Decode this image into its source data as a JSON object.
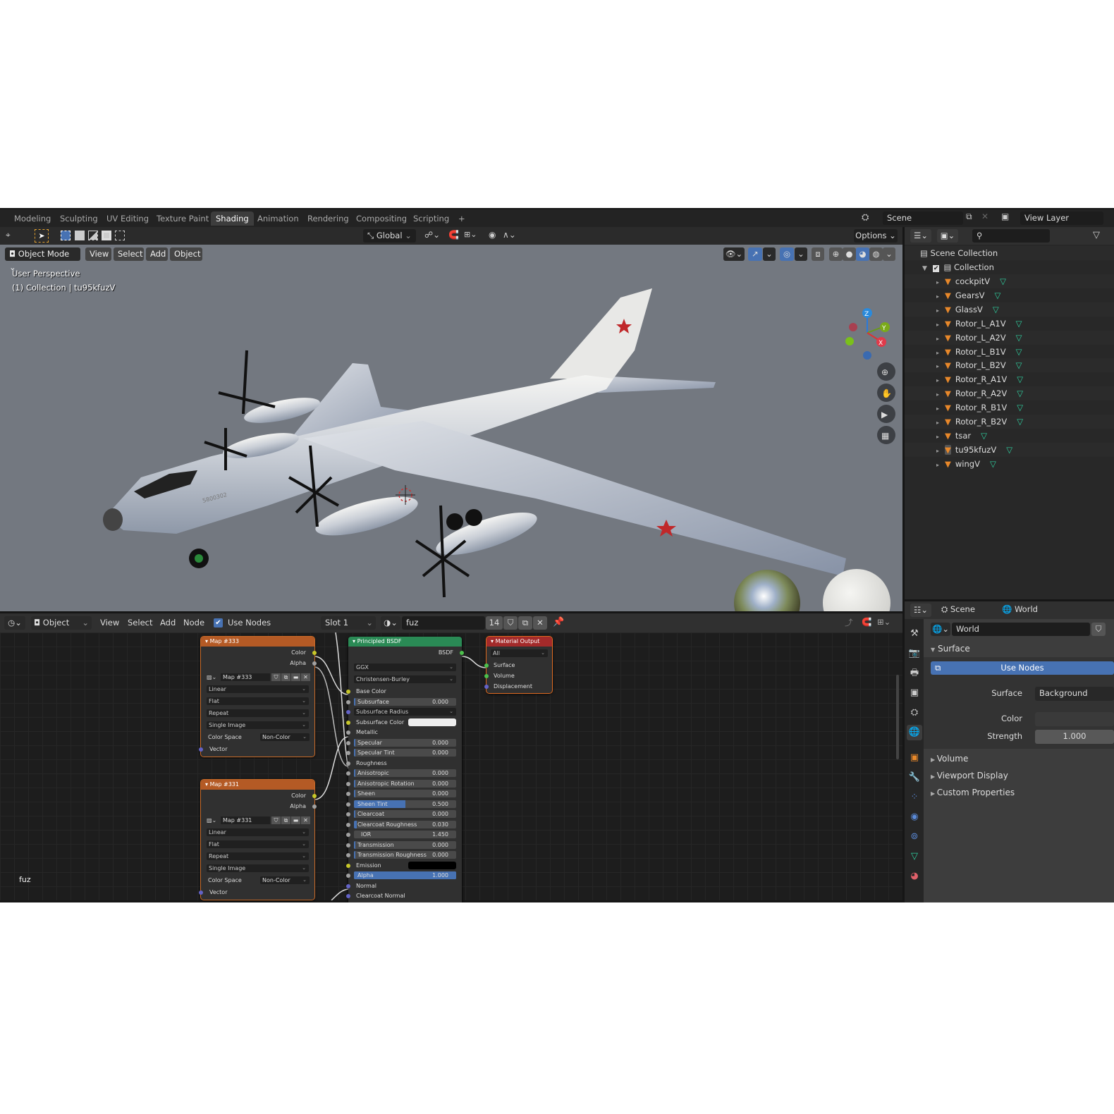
{
  "topbar": {
    "tabs": [
      "Modeling",
      "Sculpting",
      "UV Editing",
      "Texture Paint",
      "Shading",
      "Animation",
      "Rendering",
      "Compositing",
      "Scripting"
    ],
    "active_tab": "Shading",
    "add_tab": "+",
    "scene": "Scene",
    "view_layer": "View Layer"
  },
  "tool_header": {
    "orientation": "Global",
    "options": "Options"
  },
  "viewport": {
    "mode": "Object Mode",
    "menus": [
      "View",
      "Select",
      "Add",
      "Object"
    ],
    "perspective": "User Perspective",
    "collection_info": "(1) Collection | tu95kfuzV",
    "gizmo": {
      "z": "Z",
      "y": "Y",
      "x": "X"
    },
    "aircraft_marking": "5800302"
  },
  "outliner": {
    "root": "Scene Collection",
    "collection": "Collection",
    "items": [
      "cockpitV",
      "GearsV",
      "GlassV",
      "Rotor_L_A1V",
      "Rotor_L_A2V",
      "Rotor_L_B1V",
      "Rotor_L_B2V",
      "Rotor_R_A1V",
      "Rotor_R_A2V",
      "Rotor_R_B1V",
      "Rotor_R_B2V",
      "tsar",
      "tu95kfuzV",
      "wingV"
    ],
    "active_item": "tu95kfuzV"
  },
  "properties": {
    "scene": "Scene",
    "world": "World",
    "world_name": "World",
    "surface_panel": "Surface",
    "use_nodes": "Use Nodes",
    "surface_label": "Surface",
    "surface_value": "Background",
    "color_label": "Color",
    "strength_label": "Strength",
    "strength_value": "1.000",
    "panels": [
      "Volume",
      "Viewport Display",
      "Custom Properties"
    ]
  },
  "node_editor": {
    "editor_type": "Object",
    "menus": [
      "View",
      "Select",
      "Add",
      "Node"
    ],
    "use_nodes": "Use Nodes",
    "use_nodes_checked": true,
    "slot": "Slot 1",
    "material": "fuz",
    "users": "14",
    "material_label": "fuz",
    "map_nodes": [
      {
        "title": "Map #333",
        "outputs": [
          "Color",
          "Alpha"
        ],
        "image": "Map #333",
        "options": [
          "Linear",
          "Flat",
          "Repeat",
          "Single Image"
        ],
        "color_space_label": "Color Space",
        "color_space": "Non-Color",
        "input": "Vector"
      },
      {
        "title": "Map #331",
        "outputs": [
          "Color",
          "Alpha"
        ],
        "image": "Map #331",
        "options": [
          "Linear",
          "Flat",
          "Repeat",
          "Single Image"
        ],
        "color_space_label": "Color Space",
        "color_space": "Non-Color",
        "input": "Vector"
      }
    ],
    "principled": {
      "title": "Principled BSDF",
      "output": "BSDF",
      "distribution": "GGX",
      "subsurface_method": "Christensen-Burley",
      "inputs": [
        {
          "label": "Base Color",
          "kind": "socket",
          "socket": "color"
        },
        {
          "label": "Subsurface",
          "kind": "value",
          "value": "0.000",
          "fill": 0,
          "socket": "float"
        },
        {
          "label": "Subsurface Radius",
          "kind": "dropdown",
          "socket": "vector"
        },
        {
          "label": "Subsurface Color",
          "kind": "color",
          "swatch": "#eeeeee",
          "socket": "color"
        },
        {
          "label": "Metallic",
          "kind": "socket",
          "socket": "float"
        },
        {
          "label": "Specular",
          "kind": "value",
          "value": "0.000",
          "fill": 0,
          "socket": "float"
        },
        {
          "label": "Specular Tint",
          "kind": "value",
          "value": "0.000",
          "fill": 0,
          "socket": "float"
        },
        {
          "label": "Roughness",
          "kind": "socket",
          "socket": "float"
        },
        {
          "label": "Anisotropic",
          "kind": "value",
          "value": "0.000",
          "fill": 0,
          "socket": "float"
        },
        {
          "label": "Anisotropic Rotation",
          "kind": "value",
          "value": "0.000",
          "fill": 0,
          "socket": "float"
        },
        {
          "label": "Sheen",
          "kind": "value",
          "value": "0.000",
          "fill": 0,
          "socket": "float"
        },
        {
          "label": "Sheen Tint",
          "kind": "value",
          "value": "0.500",
          "fill": 0.5,
          "socket": "float"
        },
        {
          "label": "Clearcoat",
          "kind": "value",
          "value": "0.000",
          "fill": 0,
          "socket": "float"
        },
        {
          "label": "Clearcoat Roughness",
          "kind": "value",
          "value": "0.030",
          "fill": 0.03,
          "socket": "float"
        },
        {
          "label": "IOR",
          "kind": "value",
          "value": "1.450",
          "socket": "float"
        },
        {
          "label": "Transmission",
          "kind": "value",
          "value": "0.000",
          "fill": 0,
          "socket": "float"
        },
        {
          "label": "Transmission Roughness",
          "kind": "value",
          "value": "0.000",
          "fill": 0,
          "socket": "float"
        },
        {
          "label": "Emission",
          "kind": "color",
          "swatch": "#000000",
          "socket": "color"
        },
        {
          "label": "Alpha",
          "kind": "value",
          "value": "1.000",
          "fill": 1,
          "socket": "float"
        },
        {
          "label": "Normal",
          "kind": "socket",
          "socket": "vector"
        },
        {
          "label": "Clearcoat Normal",
          "kind": "socket",
          "socket": "vector"
        }
      ]
    },
    "output": {
      "title": "Material Output",
      "target": "All",
      "inputs": [
        "Surface",
        "Volume",
        "Displacement"
      ]
    }
  },
  "colors": {
    "map_header": "#b45a25",
    "principled_header": "#2a8a55",
    "output_header": "#a32a2a",
    "accent": "#4772b3",
    "socket_color": "#c7c729",
    "socket_float": "#a1a1a1",
    "socket_vector": "#6363c7",
    "socket_shader": "#4cc04c"
  }
}
